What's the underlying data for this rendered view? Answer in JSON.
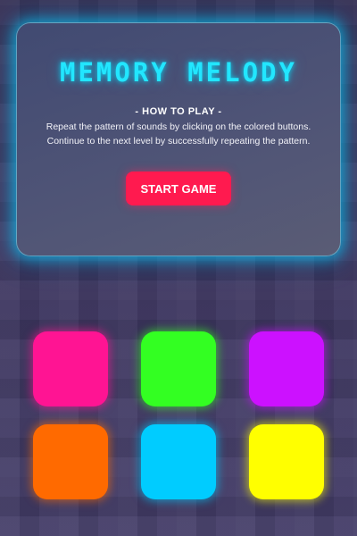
{
  "game": {
    "title": "MEMORY MELODY",
    "how_to_play_heading": "- HOW TO PLAY -",
    "instructions": [
      "Repeat the pattern of sounds by clicking on the colored buttons.",
      "Continue to the next level by successfully repeating the pattern."
    ],
    "start_label": "START GAME"
  },
  "colors": {
    "title": "#22e6ff",
    "panel_glow": "#00d2ff",
    "start_button": "#ff1a4f"
  },
  "pads": [
    {
      "name": "pink",
      "color": "#ff1493"
    },
    {
      "name": "green",
      "color": "#33ff22"
    },
    {
      "name": "purple",
      "color": "#cc11ff"
    },
    {
      "name": "orange",
      "color": "#ff6a00"
    },
    {
      "name": "cyan",
      "color": "#00ccff"
    },
    {
      "name": "yellow",
      "color": "#ffff00"
    }
  ]
}
